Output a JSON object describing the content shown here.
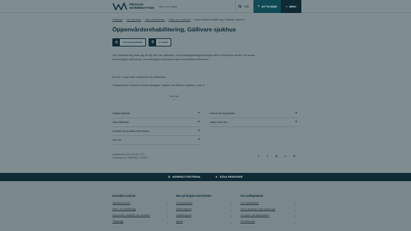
{
  "header": {
    "logo_line1": "REGION",
    "logo_line2": "NORRBOTTEN",
    "search_placeholder": "Skriv och frysa",
    "search_button": "SÖK",
    "nytta_button": "NYTTA RÅDE",
    "menu_button": "MENY"
  },
  "breadcrumb": [
    "Startsida",
    "Sök på sidan",
    "Våra vårdenheter",
    "Hälsa och sjukvård",
    "Öppenvårdsrehabilitering, Gällivare sjukhus"
  ],
  "page": {
    "title": "Öppenvårdsrehabilitering, Gällivare sjukhus",
    "btn_opening": "Arbetsklimatfakta",
    "btn_contact": "Kontakt",
    "paragraphs": [
      "Vår rehabilitering riktar sig till dig som har aktivitets- och delaktighetsbegränsningar efter exempelvis stroke och andra neurologiska sjukdomar, reumatologiska sjukdomar samt ortopediska åkommor.",
      "Du kan i regel eller remitterad via vårdenhet.",
      "Verksamheten bedrivs endast vardagar, lokalen på Gällivare sjukhus, plan 3."
    ],
    "show_more": "Visa mer"
  },
  "accordion_left": [
    "Digitala tjänster",
    "Hitta till/Besök",
    "Kontakt och praktisk information",
    "Om oss"
  ],
  "accordion_right": [
    "Lämna ditt synpunkter",
    "Jobba med oss"
  ],
  "meta": {
    "updated": "Uppdaterad: 2023-05-25, 11:01",
    "publisher": "Publicerad av: INNEHÅLL, ENHET"
  },
  "share_icons": [
    "facebook-icon",
    "twitter-icon",
    "linkedin-icon",
    "link-icon",
    "mail-icon"
  ],
  "strip": {
    "item1": "NORRBOTTENTRÄNA",
    "item2": "SÖKA RESEPÄRE"
  },
  "footer": {
    "col1": {
      "heading": "Kontakta oss/Lär",
      "links": [
        "Vårdverksamhet",
        "Skriv i ett vårdföretag",
        "Synpunkter, vårdlyfte och ansökan",
        "Tillgänglig"
      ]
    },
    "col2": {
      "heading": "Mer på Region Norrbotten",
      "links": [
        "Om Norrbotten",
        "Kulturrelaterat",
        "Utbildningsval",
        "Media"
      ]
    },
    "col3": {
      "heading": "Om webbplatsen",
      "links": [
        "Om webbplatsen",
        "Hur vi använder Nya Access (A)",
        "Om kakor på webbplatsen",
        "Om våra sida"
      ]
    }
  },
  "colors": {
    "brand_dark": "#0f2a35",
    "accent": "#0f4a55",
    "overlay_bg": "#7f8d91"
  }
}
